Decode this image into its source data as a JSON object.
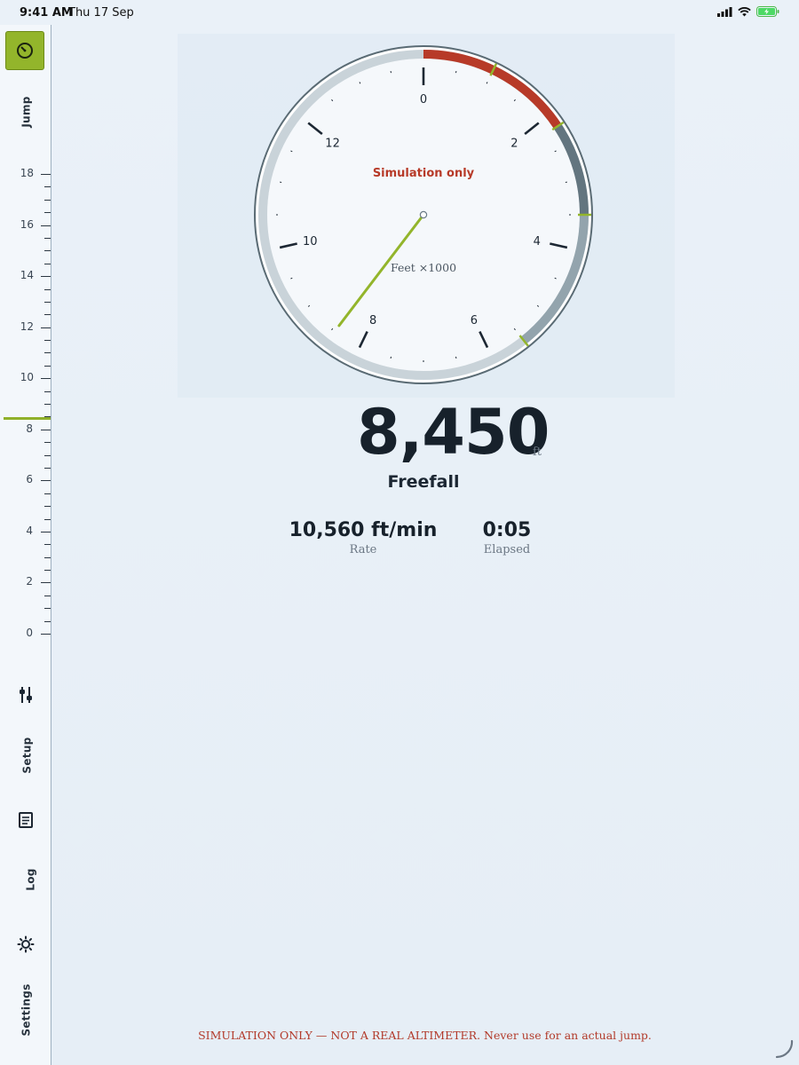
{
  "status_bar": {
    "time": "9:41 AM",
    "date": "Thu 17 Sep"
  },
  "sidebar": {
    "jump_label": "Jump",
    "setup_label": "Setup",
    "log_label": "Log",
    "settings_label": "Settings",
    "scale_labels": [
      "18",
      "16",
      "14",
      "12",
      "10",
      "8",
      "6",
      "4",
      "2",
      "0"
    ],
    "scale_max": 18,
    "current_altitude_thousands": 8.45,
    "jump_active_color": "#93b52b"
  },
  "dial": {
    "sim_label": "Simulation only",
    "units_label": "Feet ×1000",
    "numbers": [
      "0",
      "2",
      "4",
      "6",
      "8",
      "10",
      "12"
    ],
    "needle_value": 8.45,
    "colors": {
      "danger": "#b73a28",
      "decision": "#63757f",
      "pull": "#93a4ad",
      "ring": "#c9d3d9",
      "needle": "#93b52b"
    }
  },
  "readout": {
    "altitude": "8,450",
    "unit": "ft",
    "phase": "Freefall",
    "rate_value": "10,560 ft/min",
    "rate_label": "Rate",
    "elapsed_value": "0:05",
    "elapsed_label": "Elapsed"
  },
  "disclaimer": "SIMULATION ONLY — NOT A REAL ALTIMETER. Never use for an actual jump."
}
